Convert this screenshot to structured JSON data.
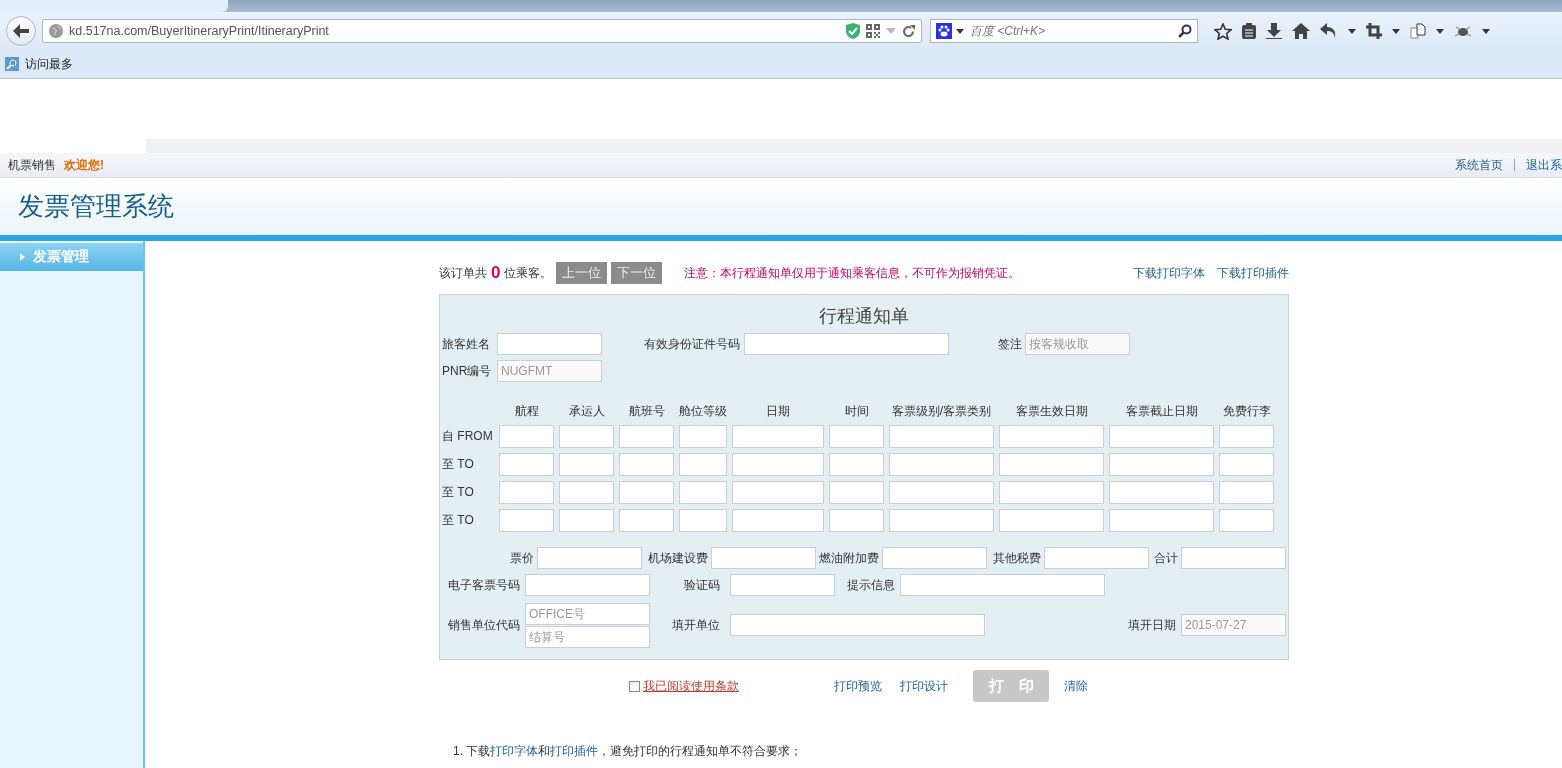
{
  "browser": {
    "url": "kd.517na.com/BuyerItineraryPrint/ItineraryPrint",
    "search_placeholder": "百度 <Ctrl+K>",
    "bookmarks": [
      "访问最多"
    ]
  },
  "topbar": {
    "section": "机票销售",
    "welcome": "欢迎您!",
    "links": [
      "系统首页",
      "退出系"
    ],
    "separator": "|"
  },
  "header": {
    "title": "发票管理系统"
  },
  "sidebar": {
    "items": [
      {
        "label": "发票管理",
        "selected": true
      }
    ]
  },
  "toolbar": {
    "count_prefix": "该订单共",
    "count": "0",
    "count_suffix": "位乘客。",
    "buttons": [
      {
        "label": "上一位",
        "disabled": true
      },
      {
        "label": "下一位",
        "disabled": true
      }
    ],
    "notice": "注意：本行程通知单仅用于通知乘客信息，不可作为报销凭证。",
    "links": [
      "下载打印字体",
      "下载打印插件"
    ]
  },
  "form": {
    "title": "行程通知单",
    "passenger": [
      {
        "label": "旅客姓名"
      },
      {
        "label": "有效身份证件号码"
      },
      {
        "label": "签注",
        "value": "按客规收取",
        "readonly": true
      }
    ],
    "pnr": {
      "label": "PNR编号",
      "value": "NUGFMT",
      "readonly": true
    },
    "segment_columns": [
      "航程",
      "承运人",
      "航班号",
      "舱位等级",
      "日期",
      "时间",
      "客票级别/客票类别",
      "客票生效日期",
      "客票截止日期",
      "免费行李"
    ],
    "segments": [
      {
        "label": "自 FROM"
      },
      {
        "label": "至 TO"
      },
      {
        "label": "至 TO"
      },
      {
        "label": "至 TO"
      }
    ],
    "fees": [
      {
        "label": "票价"
      },
      {
        "label": "机场建设费"
      },
      {
        "label": "燃油附加费"
      },
      {
        "label": "其他税费"
      },
      {
        "label": "合计"
      }
    ],
    "ticket": [
      {
        "label": "电子客票号码"
      },
      {
        "label": "验证码"
      },
      {
        "label": "提示信息"
      }
    ],
    "agent": {
      "label": "销售单位代码",
      "placeholders": [
        "OFFICE号",
        "结算号"
      ]
    },
    "issuer": {
      "label": "填开单位"
    },
    "issue_date": {
      "label": "填开日期",
      "value": "2015-07-27",
      "readonly": true
    }
  },
  "actions": {
    "agree": {
      "label": "我已阅读使用条款",
      "checked": false
    },
    "links": [
      "打印预览",
      "打印设计"
    ],
    "print_button": {
      "label": "打　印",
      "disabled": true
    },
    "clear": "清除"
  },
  "notes": [
    {
      "number": "1.",
      "parts": [
        {
          "kind": "text",
          "text": "下载"
        },
        {
          "kind": "link",
          "text": "打印字体"
        },
        {
          "kind": "text",
          "text": "和"
        },
        {
          "kind": "link",
          "text": "打印插件"
        },
        {
          "kind": "text",
          "text": "，避免打印的行程通知单不符合要求；"
        }
      ]
    }
  ]
}
